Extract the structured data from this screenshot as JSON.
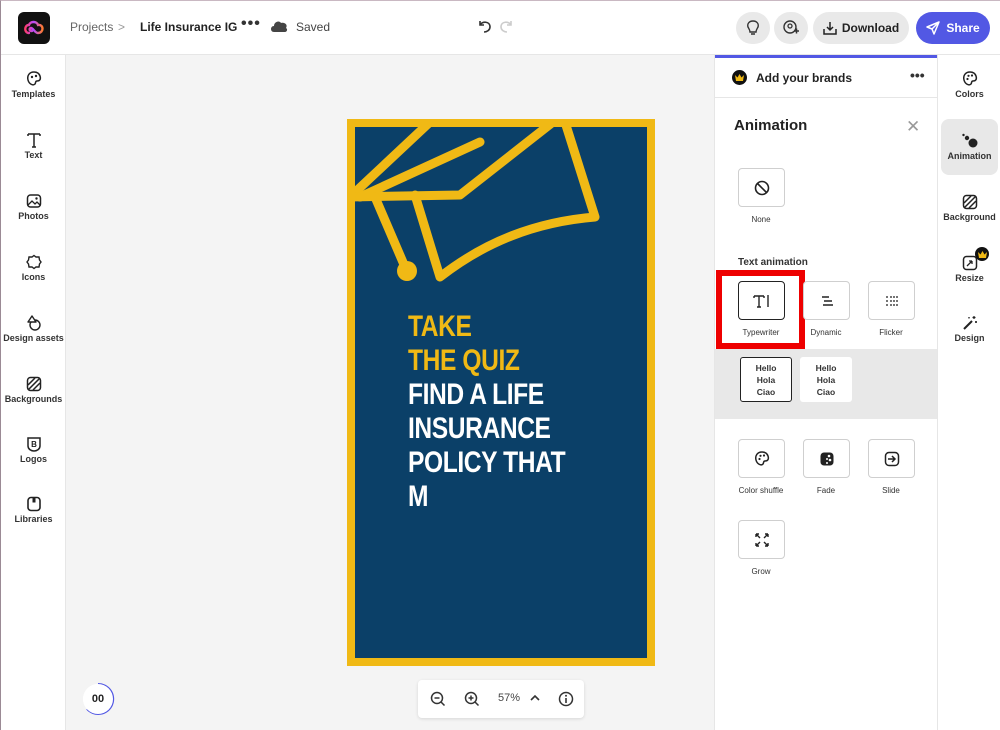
{
  "header": {
    "breadcrumb_root": "Projects",
    "breadcrumb_sep": ">",
    "project_title": "Life Insurance IG",
    "more": "•••",
    "save_status": "Saved",
    "download_label": "Download",
    "share_label": "Share",
    "accent_color": "#5258e4"
  },
  "left_sidebar": {
    "items": [
      {
        "label": "Templates",
        "icon": "templates-icon"
      },
      {
        "label": "Text",
        "icon": "text-icon"
      },
      {
        "label": "Photos",
        "icon": "photos-icon"
      },
      {
        "label": "Icons",
        "icon": "icons-icon"
      },
      {
        "label": "Design assets",
        "icon": "design-assets-icon"
      },
      {
        "label": "Backgrounds",
        "icon": "backgrounds-icon"
      },
      {
        "label": "Logos",
        "icon": "logos-icon"
      },
      {
        "label": "Libraries",
        "icon": "libraries-icon"
      }
    ]
  },
  "artboard": {
    "frame_color": "#f0b915",
    "bg_color": "#0b4068",
    "lines": [
      {
        "text": "TAKE",
        "color": "yellow"
      },
      {
        "text": "THE QUIZ",
        "color": "yellow"
      },
      {
        "text": "FIND A LIFE",
        "color": "white"
      },
      {
        "text": "INSURANCE",
        "color": "white"
      },
      {
        "text": "POLICY THAT",
        "color": "white"
      },
      {
        "text": "M",
        "color": "white"
      }
    ]
  },
  "canvas_controls": {
    "play_label": "00",
    "zoom_level": "57%"
  },
  "panel": {
    "brand_label": "Add your brands",
    "more": "•••",
    "title": "Animation",
    "close": "✕",
    "none_label": "None",
    "text_animation_label": "Text animation",
    "text_animations": [
      {
        "label": "Typewriter",
        "selected": true
      },
      {
        "label": "Dynamic",
        "selected": false
      },
      {
        "label": "Flicker",
        "selected": false
      }
    ],
    "variants": [
      {
        "lines": [
          "Hello",
          "Hola",
          "Ciao"
        ],
        "selected": true
      },
      {
        "lines": [
          "Hello",
          "Hola",
          "Ciao"
        ],
        "selected": false
      }
    ],
    "other_animations": [
      {
        "label": "Color shuffle"
      },
      {
        "label": "Fade"
      },
      {
        "label": "Slide"
      },
      {
        "label": "Grow"
      }
    ]
  },
  "right_rail": {
    "items": [
      {
        "label": "Colors"
      },
      {
        "label": "Animation",
        "active": true
      },
      {
        "label": "Background"
      },
      {
        "label": "Resize",
        "premium": true
      },
      {
        "label": "Design"
      }
    ]
  }
}
